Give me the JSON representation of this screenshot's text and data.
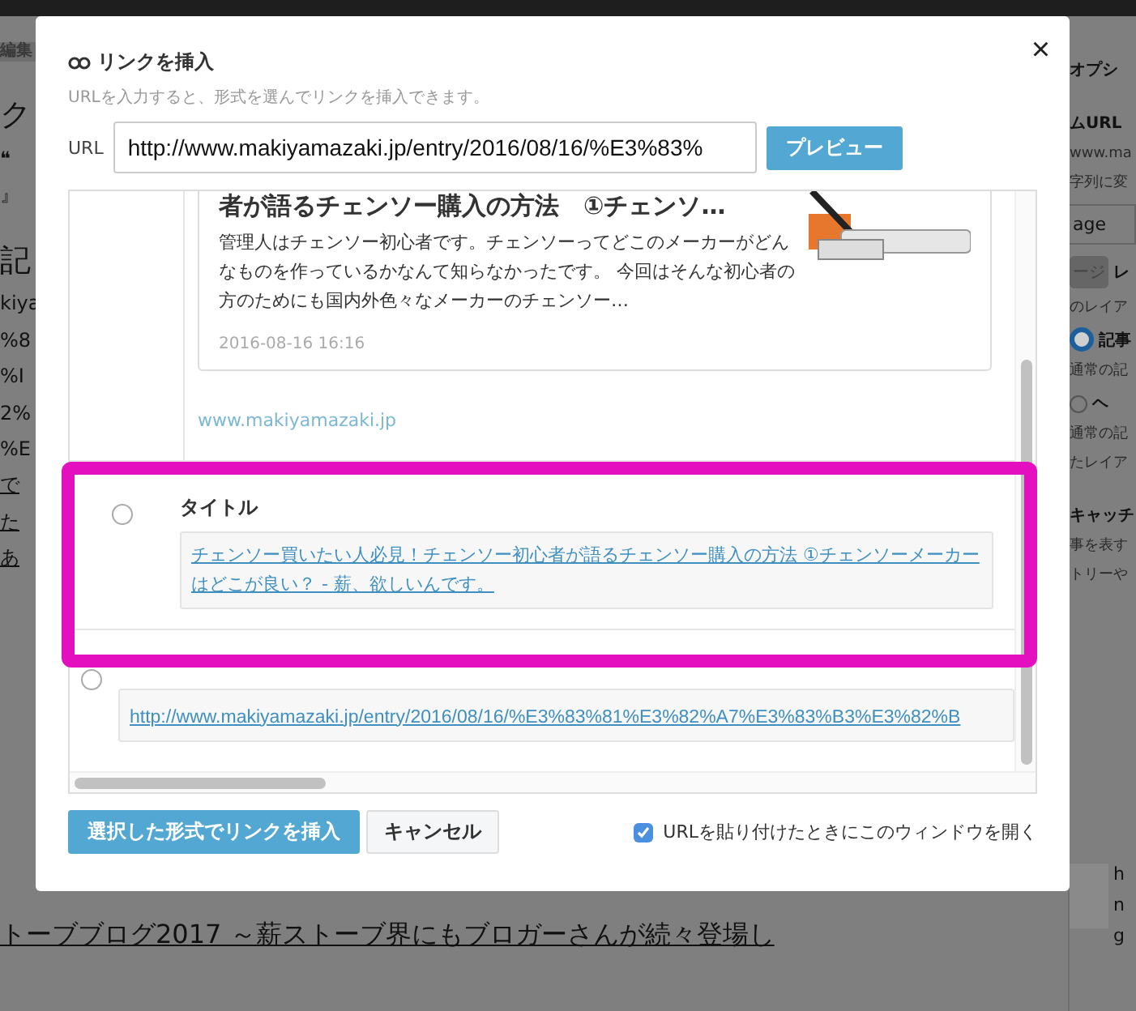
{
  "background": {
    "left_texts": [
      {
        "kind": "tab",
        "text": "編集"
      },
      {
        "kind": "heading",
        "text": "ク"
      },
      {
        "kind": "quote",
        "text": "❝"
      },
      {
        "kind": "plain",
        "text": "』"
      },
      {
        "kind": "heading",
        "text": "記"
      },
      {
        "kind": "plain",
        "text": "kiya"
      },
      {
        "kind": "plain",
        "text": "%8"
      },
      {
        "kind": "plain",
        "text": "%I"
      },
      {
        "kind": "plain",
        "text": "2%"
      },
      {
        "kind": "plain",
        "text": "%E"
      },
      {
        "kind": "link",
        "text": "で"
      },
      {
        "kind": "link",
        "text": "た"
      },
      {
        "kind": "link",
        "text": "あ"
      }
    ],
    "article_link": "トーブブログ2017 ～薪ストーブ界にもブロガーさんが続々登場し",
    "sidebar": [
      {
        "kind": "heading",
        "text": "オプシ"
      },
      {
        "kind": "heading",
        "text": "ムURL"
      },
      {
        "kind": "note",
        "text": "www.ma"
      },
      {
        "kind": "note",
        "text": "字列に変"
      },
      {
        "kind": "field",
        "text": "age"
      },
      {
        "kind": "badge",
        "text": "ージ",
        "extra": "レ"
      },
      {
        "kind": "note",
        "text": "のレイア"
      },
      {
        "kind": "radio",
        "text": "記事",
        "selected": true
      },
      {
        "kind": "note",
        "text": "通常の記"
      },
      {
        "kind": "radio",
        "text": "ヘ",
        "selected": false
      },
      {
        "kind": "note",
        "text": "通常の記"
      },
      {
        "kind": "note",
        "text": "たレイア"
      },
      {
        "kind": "heading",
        "text": "キャッチ"
      },
      {
        "kind": "note",
        "text": "事を表す"
      },
      {
        "kind": "note",
        "text": "トリーや"
      }
    ],
    "thumb_lines": [
      "h",
      "n",
      "g"
    ]
  },
  "dialog": {
    "title": "リンクを挿入",
    "subtitle": "URLを入力すると、形式を選んでリンクを挿入できます。",
    "url_label": "URL",
    "url_value": "http://www.makiyamazaki.jp/entry/2016/08/16/%E3%83%",
    "preview_button": "プレビュー",
    "close": "×",
    "options": [
      {
        "kind": "card",
        "card": {
          "title": "者が語るチェンソー購入の方法　①チェンソ…",
          "description": "管理人はチェンソー初心者です。チェンソーってどこのメーカーがどんなものを作っているかなんて知らなかったです。 今回はそんな初心者の方のためにも国内外色々なメーカーのチェンソー…",
          "date": "2016-08-16 16:16"
        },
        "site": "www.makiyamazaki.jp"
      },
      {
        "kind": "title",
        "label": "タイトル",
        "selected": false,
        "link": "チェンソー買いたい人必見！チェンソー初心者が語るチェンソー購入の方法 ①チェンソーメーカーはどこが良い？ - 薪、欲しいんです。"
      },
      {
        "kind": "url",
        "selected": false,
        "link": "http://www.makiyamazaki.jp/entry/2016/08/16/%E3%83%81%E3%82%A7%E3%83%B3%E3%82%B"
      }
    ],
    "insert_button": "選択した形式でリンクを挿入",
    "cancel_button": "キャンセル",
    "open_on_paste": {
      "label": "URLを貼り付けたときにこのウィンドウを開く",
      "checked": true
    }
  }
}
